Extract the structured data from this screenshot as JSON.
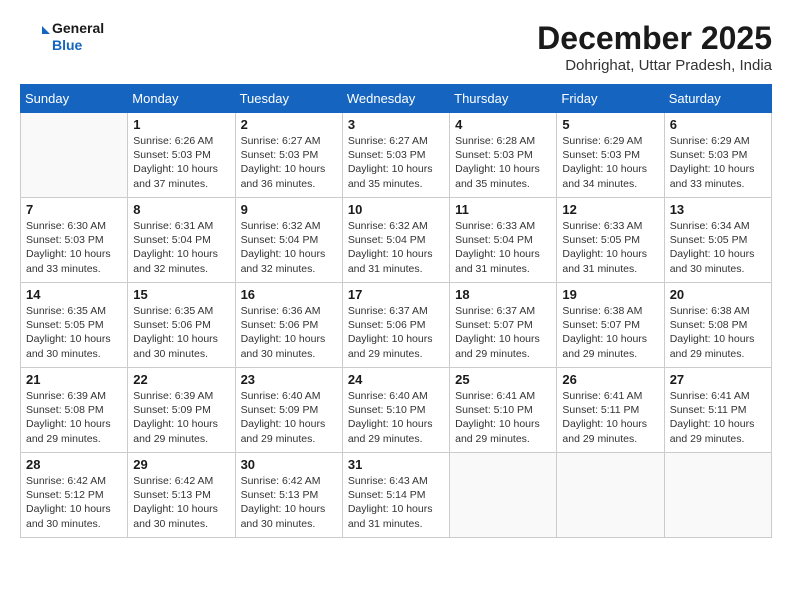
{
  "logo": {
    "general": "General",
    "blue": "Blue"
  },
  "header": {
    "month_year": "December 2025",
    "location": "Dohrighat, Uttar Pradesh, India"
  },
  "days_of_week": [
    "Sunday",
    "Monday",
    "Tuesday",
    "Wednesday",
    "Thursday",
    "Friday",
    "Saturday"
  ],
  "weeks": [
    [
      {
        "day": "",
        "info": ""
      },
      {
        "day": "1",
        "info": "Sunrise: 6:26 AM\nSunset: 5:03 PM\nDaylight: 10 hours and 37 minutes."
      },
      {
        "day": "2",
        "info": "Sunrise: 6:27 AM\nSunset: 5:03 PM\nDaylight: 10 hours and 36 minutes."
      },
      {
        "day": "3",
        "info": "Sunrise: 6:27 AM\nSunset: 5:03 PM\nDaylight: 10 hours and 35 minutes."
      },
      {
        "day": "4",
        "info": "Sunrise: 6:28 AM\nSunset: 5:03 PM\nDaylight: 10 hours and 35 minutes."
      },
      {
        "day": "5",
        "info": "Sunrise: 6:29 AM\nSunset: 5:03 PM\nDaylight: 10 hours and 34 minutes."
      },
      {
        "day": "6",
        "info": "Sunrise: 6:29 AM\nSunset: 5:03 PM\nDaylight: 10 hours and 33 minutes."
      }
    ],
    [
      {
        "day": "7",
        "info": "Sunrise: 6:30 AM\nSunset: 5:03 PM\nDaylight: 10 hours and 33 minutes."
      },
      {
        "day": "8",
        "info": "Sunrise: 6:31 AM\nSunset: 5:04 PM\nDaylight: 10 hours and 32 minutes."
      },
      {
        "day": "9",
        "info": "Sunrise: 6:32 AM\nSunset: 5:04 PM\nDaylight: 10 hours and 32 minutes."
      },
      {
        "day": "10",
        "info": "Sunrise: 6:32 AM\nSunset: 5:04 PM\nDaylight: 10 hours and 31 minutes."
      },
      {
        "day": "11",
        "info": "Sunrise: 6:33 AM\nSunset: 5:04 PM\nDaylight: 10 hours and 31 minutes."
      },
      {
        "day": "12",
        "info": "Sunrise: 6:33 AM\nSunset: 5:05 PM\nDaylight: 10 hours and 31 minutes."
      },
      {
        "day": "13",
        "info": "Sunrise: 6:34 AM\nSunset: 5:05 PM\nDaylight: 10 hours and 30 minutes."
      }
    ],
    [
      {
        "day": "14",
        "info": "Sunrise: 6:35 AM\nSunset: 5:05 PM\nDaylight: 10 hours and 30 minutes."
      },
      {
        "day": "15",
        "info": "Sunrise: 6:35 AM\nSunset: 5:06 PM\nDaylight: 10 hours and 30 minutes."
      },
      {
        "day": "16",
        "info": "Sunrise: 6:36 AM\nSunset: 5:06 PM\nDaylight: 10 hours and 30 minutes."
      },
      {
        "day": "17",
        "info": "Sunrise: 6:37 AM\nSunset: 5:06 PM\nDaylight: 10 hours and 29 minutes."
      },
      {
        "day": "18",
        "info": "Sunrise: 6:37 AM\nSunset: 5:07 PM\nDaylight: 10 hours and 29 minutes."
      },
      {
        "day": "19",
        "info": "Sunrise: 6:38 AM\nSunset: 5:07 PM\nDaylight: 10 hours and 29 minutes."
      },
      {
        "day": "20",
        "info": "Sunrise: 6:38 AM\nSunset: 5:08 PM\nDaylight: 10 hours and 29 minutes."
      }
    ],
    [
      {
        "day": "21",
        "info": "Sunrise: 6:39 AM\nSunset: 5:08 PM\nDaylight: 10 hours and 29 minutes."
      },
      {
        "day": "22",
        "info": "Sunrise: 6:39 AM\nSunset: 5:09 PM\nDaylight: 10 hours and 29 minutes."
      },
      {
        "day": "23",
        "info": "Sunrise: 6:40 AM\nSunset: 5:09 PM\nDaylight: 10 hours and 29 minutes."
      },
      {
        "day": "24",
        "info": "Sunrise: 6:40 AM\nSunset: 5:10 PM\nDaylight: 10 hours and 29 minutes."
      },
      {
        "day": "25",
        "info": "Sunrise: 6:41 AM\nSunset: 5:10 PM\nDaylight: 10 hours and 29 minutes."
      },
      {
        "day": "26",
        "info": "Sunrise: 6:41 AM\nSunset: 5:11 PM\nDaylight: 10 hours and 29 minutes."
      },
      {
        "day": "27",
        "info": "Sunrise: 6:41 AM\nSunset: 5:11 PM\nDaylight: 10 hours and 29 minutes."
      }
    ],
    [
      {
        "day": "28",
        "info": "Sunrise: 6:42 AM\nSunset: 5:12 PM\nDaylight: 10 hours and 30 minutes."
      },
      {
        "day": "29",
        "info": "Sunrise: 6:42 AM\nSunset: 5:13 PM\nDaylight: 10 hours and 30 minutes."
      },
      {
        "day": "30",
        "info": "Sunrise: 6:42 AM\nSunset: 5:13 PM\nDaylight: 10 hours and 30 minutes."
      },
      {
        "day": "31",
        "info": "Sunrise: 6:43 AM\nSunset: 5:14 PM\nDaylight: 10 hours and 31 minutes."
      },
      {
        "day": "",
        "info": ""
      },
      {
        "day": "",
        "info": ""
      },
      {
        "day": "",
        "info": ""
      }
    ]
  ]
}
